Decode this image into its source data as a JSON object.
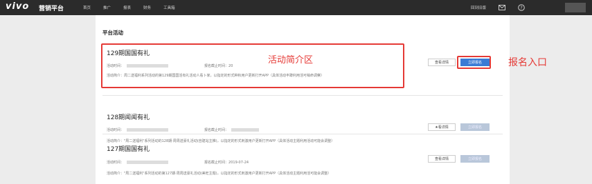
{
  "header": {
    "logo": "vivo",
    "logo_sub": "营销平台",
    "nav": [
      "首页",
      "推广",
      "报表",
      "财务",
      "工具箱"
    ],
    "right_link": "回到旧版",
    "icons": [
      "mail-icon",
      "help-icon"
    ]
  },
  "main": {
    "section_title": "平台活动",
    "cards": [
      {
        "title": "129期国国有礼",
        "meta_time_label": "活动时间：",
        "meta_deadline_label": "报名截止时间：",
        "meta_deadline_value": "20",
        "desc": "活动简介：周二送福利系列活动的第129期国国活有礼活动人看卜家，以指定的形式种秋用户更新打开APP（具体活动丰蹲利用活可稍命调察）",
        "btn_detail": "查看详情",
        "btn_signup": "立即报名",
        "signup_state": "active"
      },
      {
        "title": "128期闻闻有礼",
        "meta_time_label": "活动时间：",
        "meta_deadline_label": "报名截止时间：",
        "meta_deadline_value": "",
        "desc": "活动简介：\"周二送福利\"系列活动的128期·周周送豪礼活动(自建站主推)，以指定的形式刺激用户更新打开APP（具体活动主题利用活动可能会调整）",
        "btn_detail": "★看详情",
        "btn_signup": "立即报名",
        "signup_state": "disabled"
      },
      {
        "title": "127期国国有礼",
        "meta_time_label": "活动时间：",
        "meta_deadline_label": "报名截止时间：",
        "meta_deadline_value": "2019-07-24",
        "desc": "活动简介：\"周二送福利\"系列活动的第127期·周周送豪礼活动(美旺主题)，以指定的形式刺激用户更新打开APP（具体活动主题利用活可能会调整）",
        "btn_detail": "查看详情",
        "btn_signup": "立即报名",
        "signup_state": "disabled"
      }
    ]
  },
  "annotations": {
    "intro_area": "活动简介区",
    "signup_entry": "报名入口"
  },
  "colors": {
    "topbar": "#2b2b2b",
    "primary": "#3a7bd5",
    "annotation": "#e53935"
  }
}
